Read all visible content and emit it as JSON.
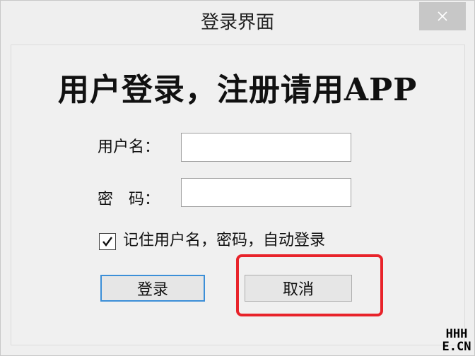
{
  "window": {
    "title": "登录界面"
  },
  "icons": {
    "close": "close-icon",
    "checkmark": "checkmark-icon"
  },
  "main": {
    "heading": "用户登录，注册请用APP",
    "username_label": "用户名：",
    "username_value": "",
    "password_label": "密　码：",
    "password_value": "",
    "remember_checked": true,
    "remember_label": "记住用户名，密码，自动登录",
    "login_button": "登录",
    "cancel_button": "取消"
  },
  "annotation": {
    "highlight_color": "#e8232a"
  },
  "watermark": {
    "line1": "HHH",
    "line2": "E.CN"
  }
}
